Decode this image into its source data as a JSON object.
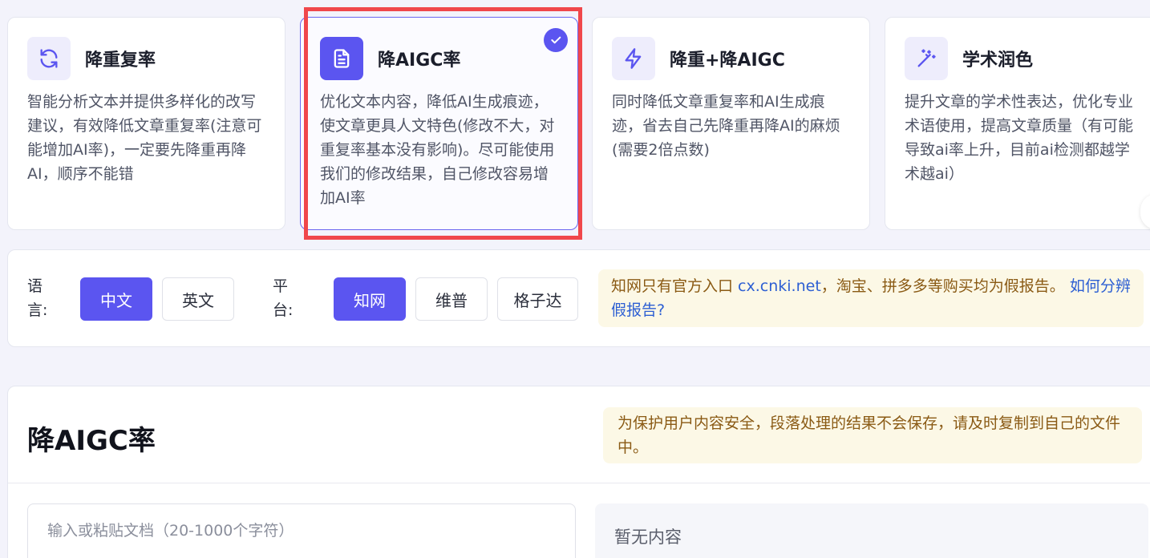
{
  "modes": [
    {
      "title": "降重复率",
      "icon": "refresh-icon",
      "desc": "智能分析文本并提供多样化的改写建议，有效降低文章重复率(注意可能增加AI率)，一定要先降重再降AI，顺序不能错"
    },
    {
      "title": "降AIGC率",
      "icon": "document-icon",
      "desc": "优化文本内容，降低AI生成痕迹，使文章更具人文特色(修改不大，对重复率基本没有影响)。尽可能使用我们的修改结果，自己修改容易增加AI率"
    },
    {
      "title": "降重+降AIGC",
      "icon": "lightning-icon",
      "desc": "同时降低文章重复率和AI生成痕迹，省去自己先降重再降AI的麻烦(需要2倍点数)"
    },
    {
      "title": "学术润色",
      "icon": "magic-wand-icon",
      "desc": "提升文章的学术性表达，优化专业术语使用，提高文章质量（有可能导致ai率上升，目前ai检测都越学术越ai）"
    }
  ],
  "selected_mode_index": 1,
  "options": {
    "language_label": "语言:",
    "languages": [
      "中文",
      "英文"
    ],
    "platform_label": "平台:",
    "platforms": [
      "知网",
      "维普",
      "格子达"
    ],
    "notice_text": "知网只有官方入口 ",
    "notice_site": "cx.cnki.net",
    "notice_rest": "，淘宝、拼多多等购买均为假报告。 ",
    "notice_link": "如何分辨假报告?"
  },
  "panel": {
    "title": "降AIGC率",
    "privacy_note": "为保护用户内容安全，段落处理的结果不会保存，请及时复制到自己的文件中。",
    "input_placeholder": "输入或粘贴文档（20-1000个字符）",
    "output_empty": "暂无内容"
  },
  "colors": {
    "accent": "#5b55f0",
    "highlight_frame": "#f0474b",
    "notice_bg": "#fcf8e6",
    "notice_text": "#8a5a14",
    "link": "#2d5fd3"
  }
}
